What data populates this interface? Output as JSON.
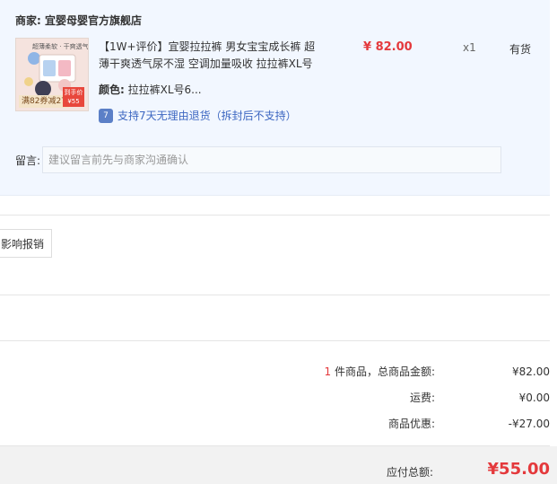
{
  "shop": {
    "label": "商家:",
    "name": "宜婴母婴官方旗舰店"
  },
  "product": {
    "image_texts": {
      "top": "超薄柔软 · 干爽透气",
      "badge": "满82券减27",
      "price_tag_line1": "到手价",
      "price_tag_line2": "¥55"
    },
    "title": "【1W+评价】宜婴拉拉裤 男女宝宝成长裤 超薄干爽透气尿不湿 空调加量吸收 拉拉裤XL号",
    "price": "¥ 82.00",
    "quantity": "x1",
    "stock": "有货",
    "spec_label": "颜色:",
    "spec_value": "拉拉裤XL号6...",
    "return_icon": "7",
    "return_policy": "支持7天无理由退货（拆封后不支持）"
  },
  "remark": {
    "label": "留言:",
    "placeholder": "建议留言前先与商家沟通确认"
  },
  "reimburse_button": "影响报销",
  "summary": {
    "item_count": "1",
    "items_label": " 件商品，总商品金额:",
    "items_amount": "¥82.00",
    "shipping_label": "运费:",
    "shipping_amount": "¥0.00",
    "discount_label": "商品优惠:",
    "discount_amount": "-¥27.00",
    "total_label": "应付总额:",
    "total_amount": "¥55.00"
  },
  "colors": {
    "accent_red": "#e4393c",
    "link_blue": "#3d67c1",
    "panel_bg": "#f2f7ff"
  }
}
